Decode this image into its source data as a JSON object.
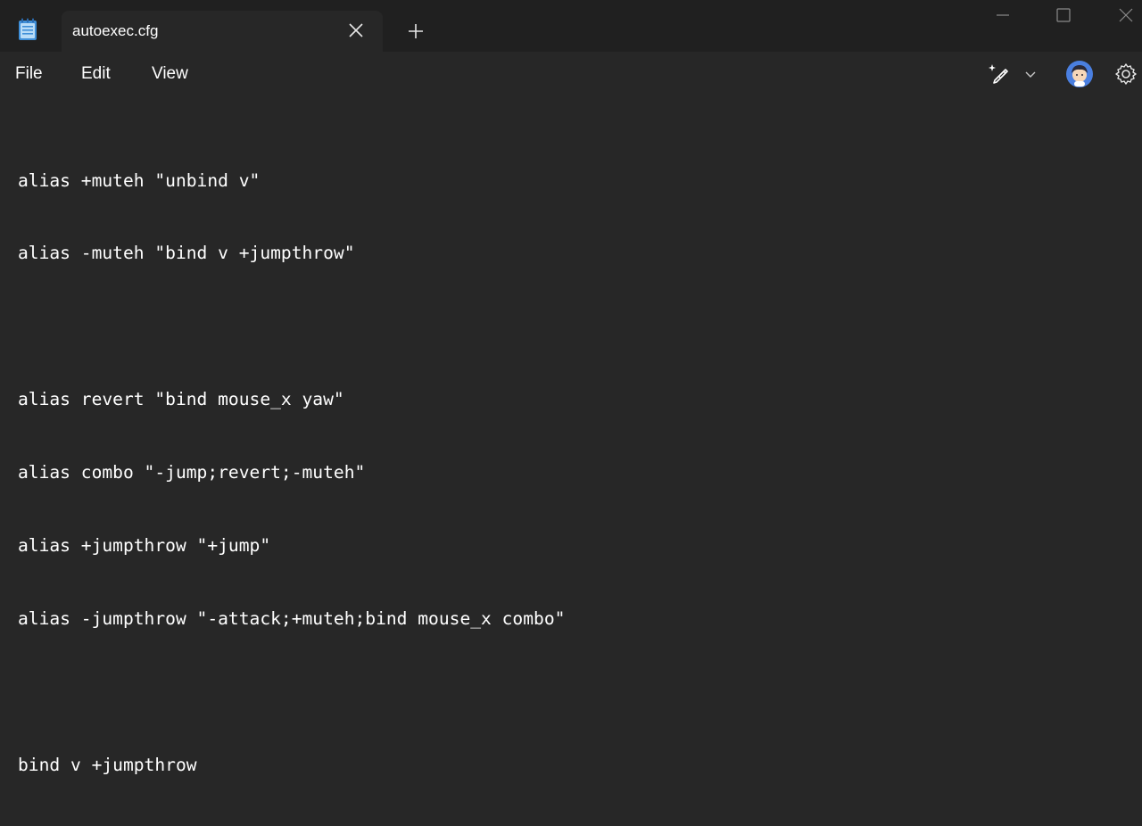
{
  "window": {
    "tab_title": "autoexec.cfg",
    "icons": {
      "app": "notepad-icon",
      "close_tab": "close-icon",
      "new_tab": "plus-icon",
      "minimize": "minimize-icon",
      "maximize": "maximize-icon",
      "close_window": "close-icon"
    }
  },
  "menu": {
    "file": "File",
    "edit": "Edit",
    "view": "View"
  },
  "toolbar": {
    "icons": [
      "copilot-rewrite-icon",
      "chevron-down-icon",
      "avatar",
      "gear-icon"
    ]
  },
  "editor": {
    "lines": [
      "alias +muteh \"unbind v\"",
      "alias -muteh \"bind v +jumpthrow\"",
      "",
      "alias revert \"bind mouse_x yaw\"",
      "alias combo \"-jump;revert;-muteh\"",
      "alias +jumpthrow \"+jump\"",
      "alias -jumpthrow \"-attack;+muteh;bind mouse_x combo\"",
      "",
      "bind v +jumpthrow"
    ]
  },
  "colors": {
    "background": "#272727",
    "titlebar": "#202020",
    "text": "#ffffff",
    "accent": "#4a7fe0"
  }
}
